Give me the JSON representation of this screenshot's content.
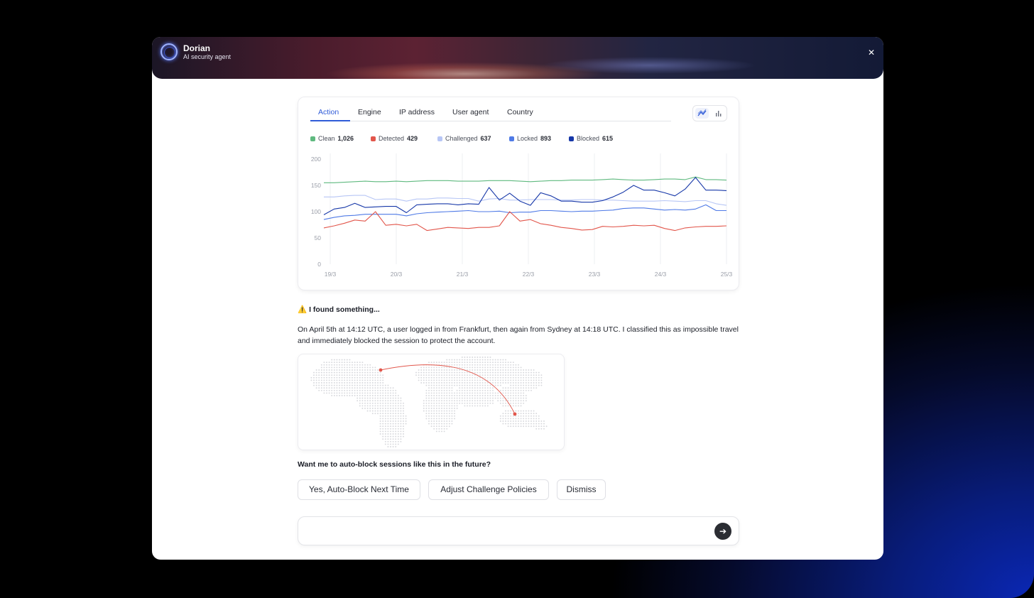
{
  "agent": {
    "name": "Dorian",
    "role": "AI security agent",
    "close_icon": "close-icon"
  },
  "tabs": [
    {
      "label": "Action",
      "active": true
    },
    {
      "label": "Engine",
      "active": false
    },
    {
      "label": "IP address",
      "active": false
    },
    {
      "label": "User agent",
      "active": false
    },
    {
      "label": "Country",
      "active": false
    }
  ],
  "view_toggle": {
    "line_icon": "line-chart-icon",
    "bar_icon": "bar-chart-icon",
    "selected": "line"
  },
  "legend": [
    {
      "label": "Clean",
      "value": "1,026",
      "color": "#5fb97f"
    },
    {
      "label": "Detected",
      "value": "429",
      "color": "#e2564b"
    },
    {
      "label": "Challenged",
      "value": "637",
      "color": "#b7c6f5"
    },
    {
      "label": "Locked",
      "value": "893",
      "color": "#4f7ae6"
    },
    {
      "label": "Blocked",
      "value": "615",
      "color": "#1637a8"
    }
  ],
  "chart_data": {
    "type": "line",
    "x": [
      "19/3",
      "20/3",
      "21/3",
      "22/3",
      "23/3",
      "24/3",
      "25/3"
    ],
    "ylim": [
      0,
      200
    ],
    "yticks": [
      0,
      50,
      100,
      150,
      200
    ],
    "grid": true,
    "series": [
      {
        "name": "Clean",
        "color": "#5fb97f",
        "values": [
          155,
          155,
          156,
          157,
          158,
          157,
          157,
          158,
          157,
          158,
          159,
          159,
          159,
          158,
          158,
          158,
          159,
          159,
          159,
          158,
          157,
          158,
          159,
          159,
          160,
          160,
          160,
          161,
          162,
          161,
          160,
          160,
          161,
          162,
          162,
          161,
          166,
          161,
          161,
          160
        ]
      },
      {
        "name": "Challenged",
        "color": "#b7c6f5",
        "values": [
          128,
          128,
          130,
          131,
          131,
          123,
          124,
          124,
          120,
          124,
          124,
          126,
          126,
          125,
          125,
          120,
          124,
          125,
          122,
          122,
          123,
          123,
          123,
          122,
          122,
          123,
          123,
          122,
          122,
          121,
          120,
          120,
          120,
          121,
          120,
          119,
          121,
          121,
          115,
          112
        ]
      },
      {
        "name": "Blocked",
        "color": "#1637a8",
        "values": [
          94,
          105,
          108,
          116,
          108,
          109,
          110,
          110,
          98,
          113,
          114,
          115,
          115,
          113,
          115,
          114,
          146,
          122,
          135,
          120,
          112,
          136,
          130,
          120,
          120,
          118,
          118,
          121,
          128,
          137,
          150,
          141,
          141,
          136,
          130,
          143,
          165,
          141,
          141,
          140
        ]
      },
      {
        "name": "Locked",
        "color": "#4f7ae6",
        "values": [
          85,
          89,
          92,
          93,
          95,
          95,
          95,
          95,
          92,
          96,
          98,
          99,
          100,
          101,
          102,
          100,
          100,
          101,
          98,
          99,
          99,
          102,
          102,
          101,
          100,
          101,
          101,
          102,
          103,
          106,
          107,
          107,
          105,
          103,
          104,
          103,
          105,
          113,
          102,
          102
        ]
      },
      {
        "name": "Detected",
        "color": "#e2564b",
        "values": [
          69,
          73,
          78,
          84,
          82,
          100,
          74,
          76,
          73,
          76,
          64,
          67,
          70,
          69,
          68,
          70,
          70,
          73,
          100,
          82,
          85,
          77,
          74,
          70,
          68,
          65,
          66,
          72,
          71,
          72,
          74,
          73,
          74,
          68,
          64,
          69,
          71,
          72,
          72,
          73
        ]
      }
    ]
  },
  "finding": {
    "warning_icon": "warning-icon",
    "warning_glyph": "⚠️",
    "title": "I found something...",
    "body": "On April 5th at 14:12 UTC, a user logged in from Frankfurt, then again from Sydney at 14:18 UTC. I classified this as impossible travel and immediately blocked the session to protect the account."
  },
  "map": {
    "arc_color": "#e2564b",
    "locations": [
      "Frankfurt",
      "Sydney"
    ]
  },
  "question": "Want me to auto-block sessions like this in the future?",
  "actions": [
    {
      "label": "Yes, Auto-Block Next Time"
    },
    {
      "label": "Adjust Challenge Policies"
    },
    {
      "label": "Dismiss"
    }
  ],
  "composer": {
    "placeholder": "",
    "send_icon": "arrow-right-icon"
  }
}
